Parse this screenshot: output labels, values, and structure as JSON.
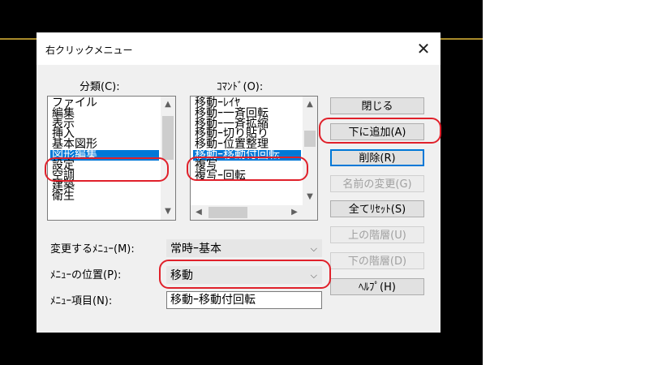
{
  "dialog": {
    "title": "右クリックメニュー",
    "close_glyph": "✕"
  },
  "category": {
    "label": "分類(C):",
    "items": [
      "ファイル",
      "編集",
      "表示",
      "挿入",
      "基本図形",
      "図形編集",
      "設定",
      "空調",
      "建築",
      "衛生"
    ],
    "selected_index": 5
  },
  "command": {
    "label": "ｺﾏﾝﾄﾞ(O):",
    "items": [
      "移動ｰﾚｲﾔ",
      "移動ｰ一斉回転",
      "移動ｰ一斉拡縮",
      "移動ｰ切り貼り",
      "移動ｰ位置整理",
      "移動ｰ移動付回転",
      "複写",
      "複写ｰ回転"
    ],
    "selected_index": 5
  },
  "buttons": {
    "close": "閉じる",
    "add_below": "下に追加(A)",
    "delete": "削除(R)",
    "rename": "名前の変更(G)",
    "reset_all": "全てﾘｾｯﾄ(S)",
    "level_up": "上の階層(U)",
    "level_down": "下の階層(D)",
    "help": "ﾍﾙﾌﾟ(H)"
  },
  "fields": {
    "change_menu_label": "変更するﾒﾆｭｰ(M):",
    "change_menu_value": "常時ｰ基本",
    "menu_position_label": "ﾒﾆｭｰの位置(P):",
    "menu_position_value": "移動",
    "menu_item_label": "ﾒﾆｭｰ項目(N):",
    "menu_item_value": "移動ｰ移動付回転"
  },
  "icons": {
    "scroll_up": "▲",
    "scroll_down": "▼",
    "scroll_left": "◀",
    "scroll_right": "▶",
    "combo_arrow": "⌵"
  },
  "colors": {
    "selection": "#0078d7",
    "annotation": "#e0202a"
  }
}
